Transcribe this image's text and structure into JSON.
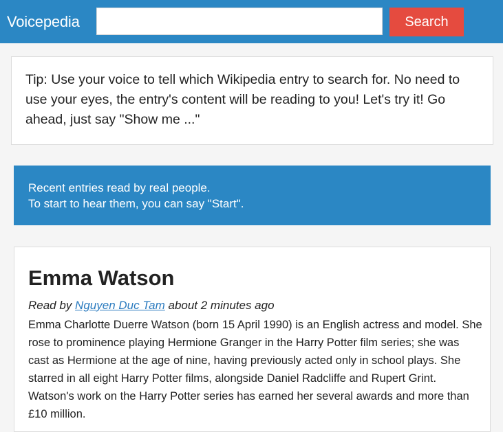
{
  "header": {
    "brand": "Voicepedia",
    "search_value": "",
    "search_placeholder": "",
    "search_button_label": "Search"
  },
  "tip": {
    "text": "Tip: Use your voice to tell which Wikipedia entry to search for. No need to use your eyes, the entry's content will be reading to you! Let's try it! Go ahead, just say \"Show me ...\""
  },
  "recent_banner": {
    "line1": "Recent entries read by real people.",
    "line2": "To start to hear them, you can say \"Start\"."
  },
  "entry": {
    "title": "Emma Watson",
    "read_by_prefix": "Read by ",
    "reader_name": "Nguyen Duc Tam",
    "time_ago": " about 2 minutes ago",
    "body": "Emma Charlotte Duerre Watson (born 15 April 1990) is an English actress and model. She rose to prominence playing Hermione Granger in the Harry Potter film series; she was cast as Hermione at the age of nine, having previously acted only in school plays. She starred in all eight Harry Potter films, alongside Daniel Radcliffe and Rupert Grint. Watson's work on the Harry Potter series has earned her several awards and more than £10 million."
  },
  "colors": {
    "primary": "#2b87c4",
    "danger": "#e54b3f",
    "link": "#2b7bbf",
    "background": "#f5f5f5"
  }
}
